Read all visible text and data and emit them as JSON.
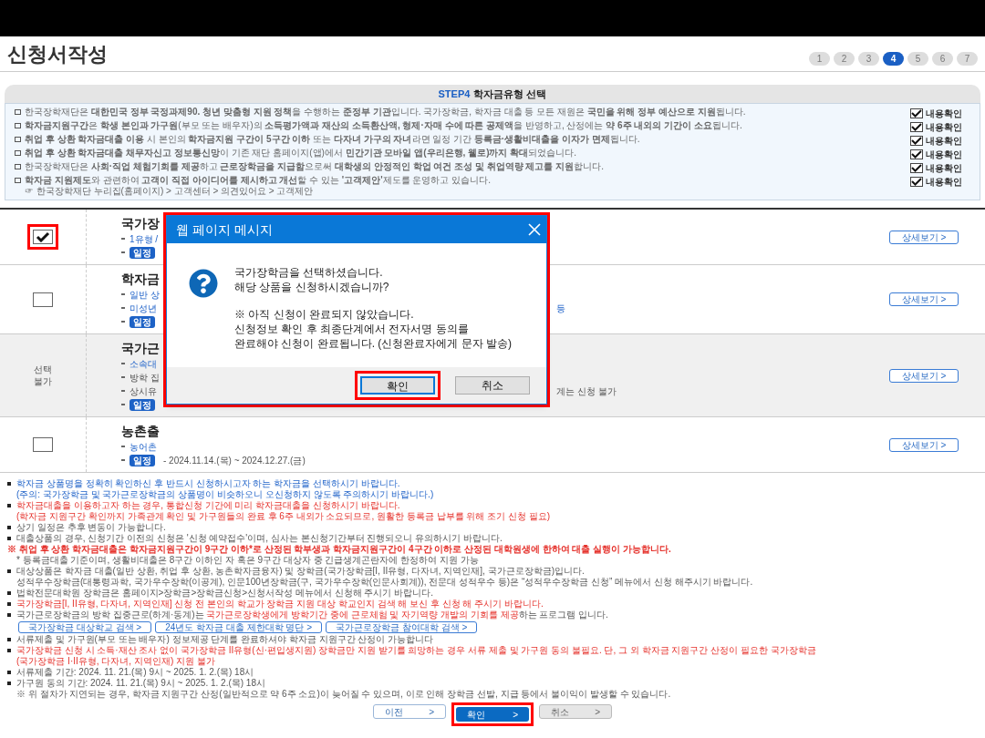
{
  "page_title": "신청서작성",
  "steps": [
    {
      "label": "1",
      "selected": false
    },
    {
      "label": "2",
      "selected": false
    },
    {
      "label": "3",
      "selected": false
    },
    {
      "label": "4",
      "selected": true
    },
    {
      "label": "5",
      "selected": false
    },
    {
      "label": "6",
      "selected": false
    },
    {
      "label": "7",
      "selected": false
    }
  ],
  "step_header": {
    "step": "STEP4",
    "title": "학자금유형 선택"
  },
  "notices": [
    {
      "text": "한국장학재단은 **대한민국 정부 국정과제90. 청년 맞춤형 지원 정책**을 수행하는 **준정부 기관**입니다. 국가장학금, 학자금 대출 등 모든 재원은 **국민을 위해 정부 예산으로 지원**됩니다.",
      "checked": true,
      "check_label": "내용확인"
    },
    {
      "text": "**학자금지원구간**은 **학생 본인과 가구원**(부모 또는 배우자)의 **소득평가액과 재산의 소득환산액, 형제·자매 수에 따른 공제액**을 반영하고, 산정에는 **약 6주 내외의 기간이 소요**됩니다.",
      "checked": true,
      "check_label": "내용확인"
    },
    {
      "text": "**취업 후 상환 학자금대출 이용** 시 본인의 **학자금지원 구간이 5구간 이하** 또는 **다자녀 가구의 자녀**라면 일정 기간 **등록금·생활비대출을 이자가 면제**됩니다.",
      "checked": true,
      "check_label": "내용확인"
    },
    {
      "text": "**취업 후 상환 학자금대출 채무자신고 정보통신망**이 기존 재단 홈페이지(앱)에서 **민간기관 모바일 앱(우리은행, 웰로)까지 확대**되었습니다.",
      "checked": true,
      "check_label": "내용확인"
    },
    {
      "text": "한국장학재단은 **사회·직업 체험기회를 제공**하고 **근로장학금을 지급함**으로써 **대학생의 안정적인 학업 여건 조성 및 취업역량 제고를 지원**합니다.",
      "checked": true,
      "check_label": "내용확인"
    },
    {
      "text": "**학자금 지원제도**와 관련하여 **고객이 직접 아이디어를 제시하고 개선**할 수 있는 **'고객제안'**제도를 운영하고 있습니다.",
      "sub": "☞ 한국장학재단 누리집(홈페이지) > 고객센터 > 의견있어요 > 고객제안",
      "checked": true,
      "check_label": "내용확인"
    }
  ],
  "products": [
    {
      "selectable": true,
      "checked": true,
      "highlighted": true,
      "shaded": false,
      "title": "국가장",
      "lines": [
        {
          "kind": "link",
          "text": "1유형 /"
        },
        {
          "kind": "schedule",
          "badge": "일정"
        }
      ],
      "detail_button": "상세보기 >"
    },
    {
      "selectable": true,
      "checked": false,
      "highlighted": false,
      "shaded": false,
      "title": "학자금",
      "lines": [
        {
          "kind": "link",
          "text": "일반 상"
        },
        {
          "kind": "link",
          "text": "미성년",
          "tail": "등"
        },
        {
          "kind": "schedule",
          "badge": "일정"
        }
      ],
      "detail_button": "상세보기 >"
    },
    {
      "selectable": false,
      "status": "선택\n불가",
      "shaded": true,
      "title": "국가근",
      "lines": [
        {
          "kind": "link",
          "text": "소속대"
        },
        {
          "kind": "plain",
          "text": "방학 집"
        },
        {
          "kind": "plain",
          "text": "상시유",
          "tail": "계는 신청 불가"
        },
        {
          "kind": "schedule",
          "badge": "일정"
        }
      ],
      "detail_button": "상세보기 >"
    },
    {
      "selectable": true,
      "checked": false,
      "highlighted": false,
      "shaded": false,
      "title": "농촌출",
      "lines": [
        {
          "kind": "link",
          "text": "농어촌"
        },
        {
          "kind": "schedule",
          "badge": "일정",
          "text": "- 2024.11.14.(목) ~ 2024.12.27.(금)"
        }
      ],
      "detail_button": "상세보기 >"
    }
  ],
  "dialog": {
    "title": "웹 페이지 메시지",
    "highlighted": true,
    "message": [
      "국가장학금을 선택하셨습니다.",
      "해당 상품을 신청하시겠습니까?"
    ],
    "notice": [
      "※ 아직 신청이 완료되지 않았습니다.",
      "신청정보 확인 후 최종단계에서 전자서명 동의를",
      "완료해야 신청이 완료됩니다. (신청완료자에게 문자 발송)"
    ],
    "buttons": [
      {
        "label": "확인",
        "focused": true,
        "highlighted": true
      },
      {
        "label": "취소",
        "focused": false,
        "highlighted": false
      }
    ]
  },
  "notes": [
    {
      "kind": "bullet",
      "segments": [
        {
          "kind": "info",
          "text": "학자금 상품명을 정확히 확인하신 후 반드시 신청하시고자 하는 학자금을 선택하시기 바랍니다."
        }
      ],
      "subs": [
        {
          "kind": "info",
          "text": "(주의: 국가장학금 및 국가근로장학금의 상품명이 비슷하오니 오신청하지 않도록 주의하시기 바랍니다.)"
        }
      ]
    },
    {
      "kind": "bullet",
      "segments": [
        {
          "kind": "alert",
          "text": "학자금대출을 이용하고자 하는 경우, 통합신청 기간에 미리 학자금대출을 신청하시기 바랍니다."
        }
      ],
      "subs": [
        {
          "kind": "alert",
          "text": "(학자금 지원구간 확인까지 가족관계 확인 및 가구원들의 완료 후 6주 내외가 소요되므로, 원활한 등록금 납부를 위해 조기 신청 필요)"
        }
      ]
    },
    {
      "kind": "bullet",
      "segments": [
        {
          "kind": "plain",
          "text": "상기 일정은 추후 변동이 가능합니다."
        }
      ]
    },
    {
      "kind": "bullet",
      "segments": [
        {
          "kind": "plain",
          "text": "대출상품의 경우, 신청기간 이전의 신청은 '신청 예약접수'이며, 심사는 본신청기간부터 진행되오니 유의하시기 바랍니다."
        }
      ]
    },
    {
      "kind": "mark",
      "segments": [
        {
          "kind": "strong",
          "text": "※ 취업 후 상환 학자금대출은 학자금지원구간이 9구간 이하*로 산정된 학부생과 학자금지원구간이 4구간 이하로 산정된 대학원생에 한하여 대출 실행이 가능합니다."
        }
      ],
      "subs": [
        {
          "kind": "plain",
          "text": "* 등록금대출 기준이며, 생활비대출은 8구간 이하인 자 혹은 9구간 대상자 중 긴급생계곤란자에 한정하여 지원 가능"
        }
      ]
    },
    {
      "kind": "bullet",
      "segments": [
        {
          "kind": "plain",
          "text": "대상상품은 학자금 대출(일반 상환, 취업 후 상환, 농촌학자금융자) 및 장학금(국가장학금[I, II유형, 다자녀, 지역인재], 국가근로장학금)입니다."
        }
      ],
      "subs": [
        {
          "kind": "plain",
          "text": "성적우수장학금(대통령과학, 국가우수장학(이공계), 인문100년장학금(구, 국가우수장학(인문사회계)), 전문대 성적우수 등)은 “성적우수장학금 신청” 메뉴에서 신청 해주시기 바랍니다."
        }
      ]
    },
    {
      "kind": "bullet",
      "segments": [
        {
          "kind": "plain",
          "text": "법학전문대학원 장학금은 홈페이지>장학금>장학금신청>신청서작성 메뉴에서 신청해 주시기 바랍니다."
        }
      ]
    },
    {
      "kind": "bullet",
      "segments": [
        {
          "kind": "alert",
          "text": "국가장학금[I, II유형, 다자녀, 지역인재] 신청 전 본인의 학교가 장학금 지원 대상 학교인지 검색 해 보신 후 신청 해 주시기 바랍니다."
        }
      ]
    },
    {
      "kind": "bullet",
      "segments": [
        {
          "kind": "plain",
          "text": "국가근로장학금의 방학 집중근로(하계·동계)는 "
        },
        {
          "kind": "alert",
          "text": "국가근로장학생에게 방학기간 중에 근로체험 및 자기역량 개발의 기회를 제공"
        },
        {
          "kind": "plain",
          "text": "하는 프로그램 입니다."
        }
      ]
    },
    {
      "kind": "links",
      "buttons": [
        "국가장학금 대상학교 검색 >",
        "24년도 학자금 대출 제한대학 명단 >",
        "국가근로장학금 참여대학 검색 >"
      ]
    },
    {
      "kind": "bullet",
      "segments": [
        {
          "kind": "plain",
          "text": "서류제출 및 가구원(부모 또는 배우자) 정보제공 단계를 완료하셔야 학자금 지원구간 산정이 가능합니다"
        }
      ]
    },
    {
      "kind": "bullet",
      "segments": [
        {
          "kind": "alert",
          "text": "국가장학금 신청 시 소득·재산 조사 없이 국가장학금 II유형(신·편입생지원) 장학금만 지원 받기를 희망하는 경우 서류 제출 및 가구원 동의 불필요. 단, 그 외 학자금 지원구간 산정이 필요한 국가장학금"
        }
      ],
      "subs": [
        {
          "kind": "alert",
          "text": "(국가장학금 I·II유형, 다자녀, 지역인재) 지원 불가"
        }
      ]
    },
    {
      "kind": "bullet",
      "segments": [
        {
          "kind": "plain",
          "text": "서류제출 기간: 2024. 11. 21.(목) 9시 ~ 2025. 1. 2.(목) 18시"
        }
      ]
    },
    {
      "kind": "bullet",
      "segments": [
        {
          "kind": "plain",
          "text": "가구원 동의 기간: 2024. 11. 21.(목) 9시 ~ 2025. 1. 2.(목) 18시"
        }
      ],
      "subs": [
        {
          "kind": "plain",
          "text": "※ 위 절차가 지연되는 경우, 학자금 지원구간 산정(일반적으로 약 6주 소요)이 늦어질 수 있으며, 이로 인해 장학금 선발, 지급 등에서 불이익이 발생할 수 있습니다."
        }
      ]
    }
  ],
  "nav_buttons": [
    {
      "label": "이전",
      "arrow": ">",
      "kind": "outline",
      "highlighted": false
    },
    {
      "label": "확인",
      "arrow": ">",
      "kind": "primary",
      "highlighted": true
    },
    {
      "label": "취소",
      "arrow": ">",
      "kind": "gray",
      "highlighted": false
    }
  ]
}
